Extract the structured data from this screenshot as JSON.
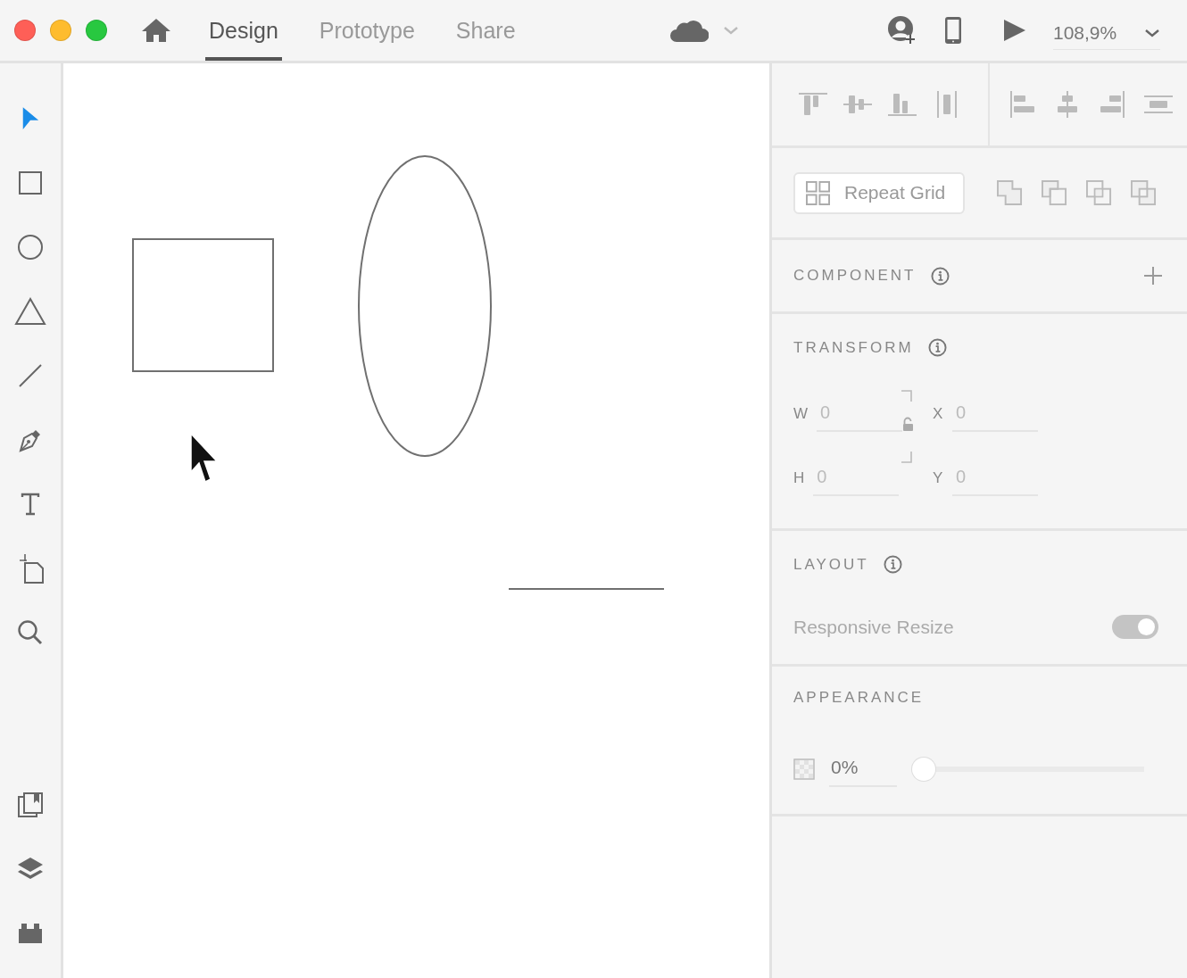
{
  "window_controls": [
    {
      "kind": "close"
    },
    {
      "kind": "minimize"
    },
    {
      "kind": "zoom"
    }
  ],
  "tabs": [
    {
      "label": "Design",
      "selected": true
    },
    {
      "label": "Prototype",
      "selected": false
    },
    {
      "label": "Share",
      "selected": false
    }
  ],
  "zoom": {
    "value": "108,9%"
  },
  "tools": [
    {
      "kind": "select",
      "selected": true
    },
    {
      "kind": "rectangle",
      "selected": false
    },
    {
      "kind": "ellipse",
      "selected": false
    },
    {
      "kind": "polygon",
      "selected": false
    },
    {
      "kind": "line",
      "selected": false
    },
    {
      "kind": "pen",
      "selected": false
    },
    {
      "kind": "text",
      "selected": false
    },
    {
      "kind": "artboard",
      "selected": false
    },
    {
      "kind": "zoom",
      "selected": false
    }
  ],
  "bottom_tools": [
    {
      "kind": "assets"
    },
    {
      "kind": "layers"
    },
    {
      "kind": "plugins"
    }
  ],
  "repeat_grid": {
    "label": "Repeat Grid"
  },
  "component": {
    "title": "COMPONENT"
  },
  "transform": {
    "title": "TRANSFORM",
    "fields": [
      {
        "label": "W",
        "placeholder": "0"
      },
      {
        "label": "X",
        "placeholder": "0"
      },
      {
        "label": "H",
        "placeholder": "0"
      },
      {
        "label": "Y",
        "placeholder": "0"
      }
    ]
  },
  "layout": {
    "title": "LAYOUT",
    "responsive_resize": {
      "label": "Responsive Resize",
      "on": true,
      "disabled": true
    }
  },
  "appearance": {
    "title": "APPEARANCE",
    "opacity": {
      "value": "0%",
      "level": 0
    }
  }
}
